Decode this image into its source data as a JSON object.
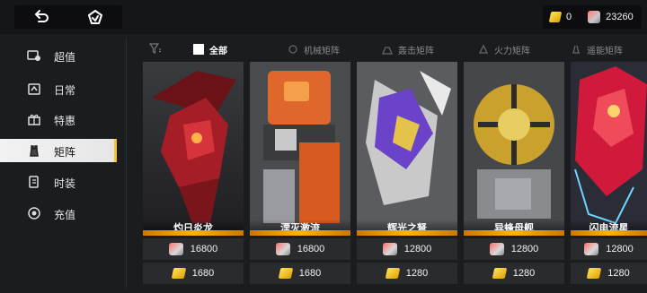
{
  "header": {
    "back_icon": "back-arrow-icon",
    "home_icon": "home-icon",
    "currency": {
      "gold_icon": "gold-gem-icon",
      "gold_value": "0",
      "cube_icon": "cube-icon",
      "cube_value": "23260"
    }
  },
  "sidebar": {
    "items": [
      {
        "label": "超值",
        "icon": "value-icon"
      },
      {
        "label": "日常",
        "icon": "daily-icon"
      },
      {
        "label": "特惠",
        "icon": "gift-icon"
      },
      {
        "label": "矩阵",
        "icon": "matrix-icon"
      },
      {
        "label": "时装",
        "icon": "fashion-icon"
      },
      {
        "label": "充值",
        "icon": "recharge-icon"
      }
    ],
    "active_index": 3
  },
  "filters": {
    "filter_icon": "filter-icon",
    "items": [
      {
        "label": "全部",
        "active": true
      },
      {
        "label": "机械矩阵",
        "active": false
      },
      {
        "label": "轰击矩阵",
        "active": false
      },
      {
        "label": "火力矩阵",
        "active": false
      },
      {
        "label": "遥能矩阵",
        "active": false
      }
    ]
  },
  "cards": [
    {
      "name": "灼日炎龙",
      "price_cube": "16800",
      "price_gold": "1680",
      "theme": "#b51f2a"
    },
    {
      "name": "湮灭激流",
      "price_cube": "16800",
      "price_gold": "1680",
      "theme": "#e0672b"
    },
    {
      "name": "辉光之弩",
      "price_cube": "12800",
      "price_gold": "1280",
      "theme": "#6b43c8"
    },
    {
      "name": "异蜂母舰",
      "price_cube": "12800",
      "price_gold": "1280",
      "theme": "#c9a12c"
    },
    {
      "name": "闪电流星",
      "price_cube": "12800",
      "price_gold": "1280",
      "theme": "#d11a3b"
    }
  ],
  "colors": {
    "accent_gold": "#f2c53d",
    "bg": "#1b1c1f",
    "panel": "#2a2b2e"
  }
}
